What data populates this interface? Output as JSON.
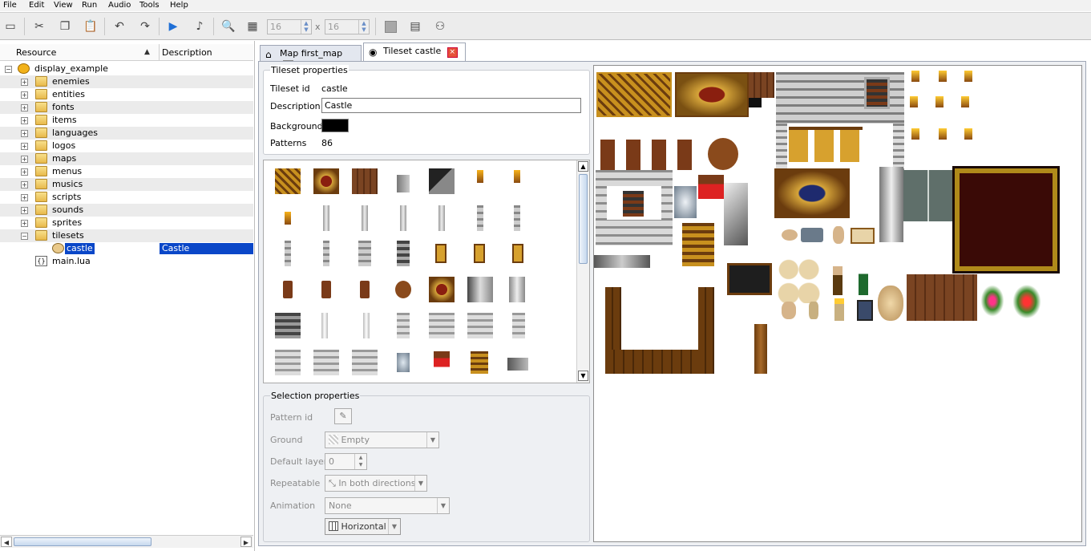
{
  "menu": [
    "File",
    "Edit",
    "View",
    "Run",
    "Audio",
    "Tools",
    "Help"
  ],
  "toolbar": {
    "grid_w": "16",
    "x_sep": "x",
    "grid_h": "16"
  },
  "tree": {
    "header_resource": "Resource",
    "header_description": "Description",
    "root": "display_example",
    "items": [
      {
        "label": "enemies"
      },
      {
        "label": "entities"
      },
      {
        "label": "fonts"
      },
      {
        "label": "items"
      },
      {
        "label": "languages"
      },
      {
        "label": "logos"
      },
      {
        "label": "maps"
      },
      {
        "label": "menus"
      },
      {
        "label": "musics"
      },
      {
        "label": "scripts"
      },
      {
        "label": "sounds"
      },
      {
        "label": "sprites"
      },
      {
        "label": "tilesets"
      }
    ],
    "selected": {
      "label": "castle",
      "description": "Castle"
    },
    "last": "main.lua"
  },
  "tabs": [
    {
      "label": "Map first_map"
    },
    {
      "label": "Tileset castle"
    }
  ],
  "tileset_props": {
    "title": "Tileset properties",
    "id_label": "Tileset id",
    "id_value": "castle",
    "desc_label": "Description",
    "desc_value": "Castle",
    "bg_label": "Background",
    "bg_color": "#000000",
    "patterns_label": "Patterns",
    "patterns_value": "86"
  },
  "selection_props": {
    "title": "Selection properties",
    "pattern_id_label": "Pattern id",
    "ground_label": "Ground",
    "ground_value": "Empty",
    "default_layer_label": "Default layer",
    "default_layer_value": "0",
    "repeatable_label": "Repeatable",
    "repeatable_value": "In both directions",
    "animation_label": "Animation",
    "animation_value": "None",
    "animation_dir": "Horizontal"
  },
  "colors": {
    "selection": "#0a47c8",
    "accent": "#1f6fd6"
  }
}
